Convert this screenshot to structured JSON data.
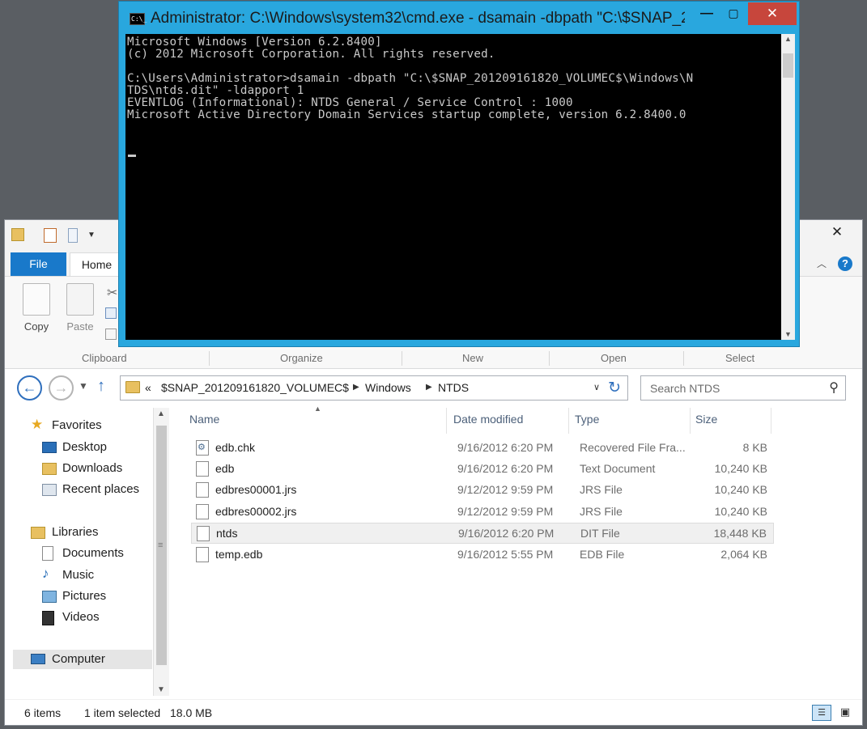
{
  "cmd": {
    "title": "Administrator: C:\\Windows\\system32\\cmd.exe - dsamain  -dbpath \"C:\\$SNAP_2...",
    "icon_text": "C:\\_",
    "lines": [
      "Microsoft Windows [Version 6.2.8400]",
      "(c) 2012 Microsoft Corporation. All rights reserved.",
      "",
      "C:\\Users\\Administrator>dsamain -dbpath \"C:\\$SNAP_201209161820_VOLUMEC$\\Windows\\N",
      "TDS\\ntds.dit\" -ldapport 1",
      "EVENTLOG (Informational): NTDS General / Service Control : 1000",
      "Microsoft Active Directory Domain Services startup complete, version 6.2.8400.0"
    ],
    "min_glyph": "—",
    "max_glyph": "▢",
    "close_glyph": "✕"
  },
  "explorer": {
    "close_glyph": "✕",
    "ribbon": {
      "tabs": {
        "file": "File",
        "home": "Home"
      },
      "buttons": {
        "copy": "Copy",
        "paste": "Paste"
      },
      "groups": {
        "clipboard": "Clipboard",
        "organize": "Organize",
        "new": "New",
        "open": "Open",
        "select": "Select"
      },
      "help_glyph": "?"
    },
    "address": {
      "crumbs": [
        "«",
        "$SNAP_201209161820_VOLUMEC$",
        "Windows",
        "NTDS"
      ],
      "separator": "▶",
      "search_placeholder": "Search NTDS"
    },
    "nav": {
      "favorites": "Favorites",
      "desktop": "Desktop",
      "downloads": "Downloads",
      "recent": "Recent places",
      "libraries": "Libraries",
      "documents": "Documents",
      "music": "Music",
      "pictures": "Pictures",
      "videos": "Videos",
      "computer": "Computer"
    },
    "columns": {
      "name": "Name",
      "date": "Date modified",
      "type": "Type",
      "size": "Size"
    },
    "files": [
      {
        "name": "edb.chk",
        "date": "9/16/2012 6:20 PM",
        "type": "Recovered File Fra...",
        "size": "8 KB"
      },
      {
        "name": "edb",
        "date": "9/16/2012 6:20 PM",
        "type": "Text Document",
        "size": "10,240 KB"
      },
      {
        "name": "edbres00001.jrs",
        "date": "9/12/2012 9:59 PM",
        "type": "JRS File",
        "size": "10,240 KB"
      },
      {
        "name": "edbres00002.jrs",
        "date": "9/12/2012 9:59 PM",
        "type": "JRS File",
        "size": "10,240 KB"
      },
      {
        "name": "ntds",
        "date": "9/16/2012 6:20 PM",
        "type": "DIT File",
        "size": "18,448 KB"
      },
      {
        "name": "temp.edb",
        "date": "9/16/2012 5:55 PM",
        "type": "EDB File",
        "size": "2,064 KB"
      }
    ],
    "status": {
      "items": "6 items",
      "selected": "1 item selected",
      "size": "18.0 MB"
    }
  }
}
